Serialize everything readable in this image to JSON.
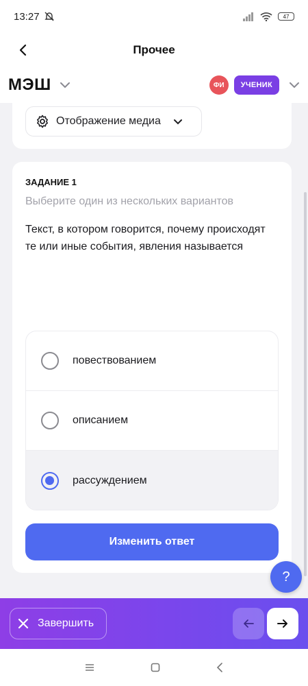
{
  "status": {
    "time": "13:27",
    "battery": "47"
  },
  "topbar": {
    "title": "Прочее"
  },
  "appbar": {
    "logo": "МЭШ",
    "avatar_initials": "ФИ",
    "role": "УЧЕНИК"
  },
  "media": {
    "label": "Отображение медиа"
  },
  "task": {
    "number": "ЗАДАНИЕ 1",
    "hint": "Выберите один из нескольких вариантов",
    "question": "Текст, в котором говорится, почему происходят те или иные события, явления называется",
    "options": [
      {
        "label": "повествованием",
        "selected": false
      },
      {
        "label": "описанием",
        "selected": false
      },
      {
        "label": "рассуждением",
        "selected": true
      }
    ],
    "submit_label": "Изменить ответ"
  },
  "help": {
    "label": "?"
  },
  "bottom": {
    "finish_label": "Завершить"
  },
  "colors": {
    "accent": "#4f6af0",
    "role_badge": "#7a3fe4",
    "avatar": "#e8545a"
  }
}
